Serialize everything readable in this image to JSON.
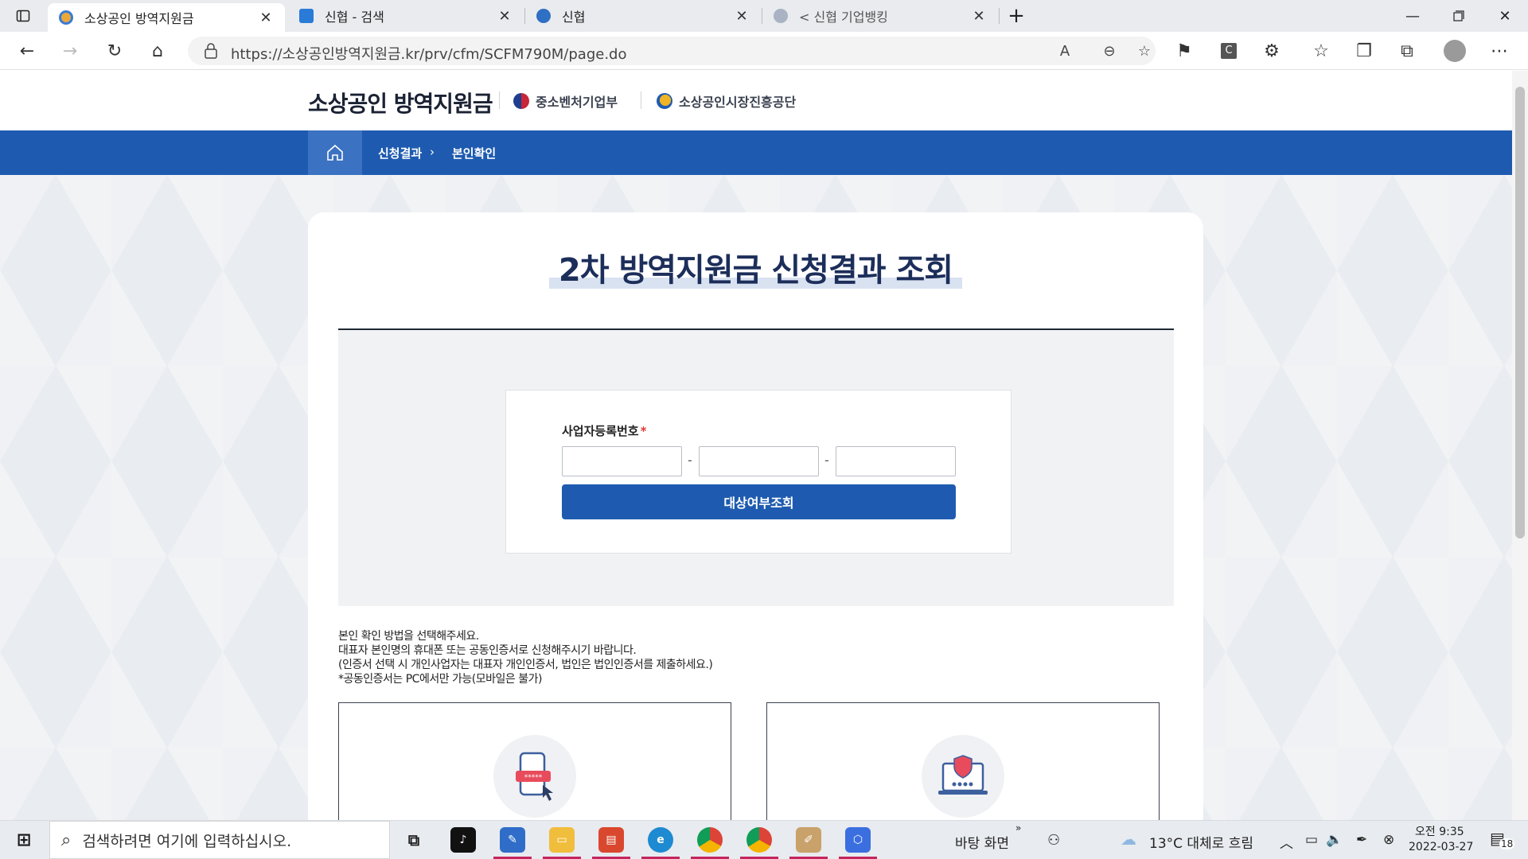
{
  "browser": {
    "tabs": [
      {
        "title": "소상공인 방역지원금",
        "active": true,
        "favicon_color": "#e8a93a"
      },
      {
        "title": "신협 - 검색",
        "active": false,
        "favicon_color": "#2a7ad8"
      },
      {
        "title": "신협",
        "active": false,
        "favicon_color": "#2f6fc4"
      },
      {
        "title": "< 신협 기업뱅킹",
        "active": false,
        "favicon_color": "#a9b3c3"
      }
    ],
    "url": "https://소상공인방역지원금.kr/prv/cfm/SCFM790M/page.do"
  },
  "site": {
    "logo": "소상공인 방역지원금",
    "partner1": "중소벤처기업부",
    "partner2": "소상공인시장진흥공단",
    "breadcrumb": [
      "신청결과",
      "본인확인"
    ],
    "title": "2차 방역지원금 신청결과 조회",
    "form": {
      "label": "사업자등록번호",
      "required_mark": "*",
      "separator": "-",
      "submit_label": "대상여부조회"
    },
    "notes": [
      "본인 확인 방법을 선택해주세요.",
      "대표자 본인명의 휴대폰 또는 공동인증서로 신청해주시기 바랍니다.",
      "(인증서 선택 시 개인사업자는 대표자 개인인증서, 법인은 법인인증서를 제출하세요.)",
      "*공동인증서는 PC에서만 가능(모바일은 불가)"
    ],
    "options": [
      {
        "icon": "phone-auth-icon"
      },
      {
        "icon": "certificate-auth-icon"
      }
    ]
  },
  "taskbar": {
    "search_placeholder": "검색하려면 여기에 입력하십시오.",
    "desktop_label": "바탕 화면",
    "weather": "13°C  대체로 흐림",
    "time": "오전 9:35",
    "date": "2022-03-27",
    "notification_count": "18"
  },
  "colors": {
    "brand_blue": "#1e5bb0",
    "title_navy": "#1c2e5a"
  }
}
